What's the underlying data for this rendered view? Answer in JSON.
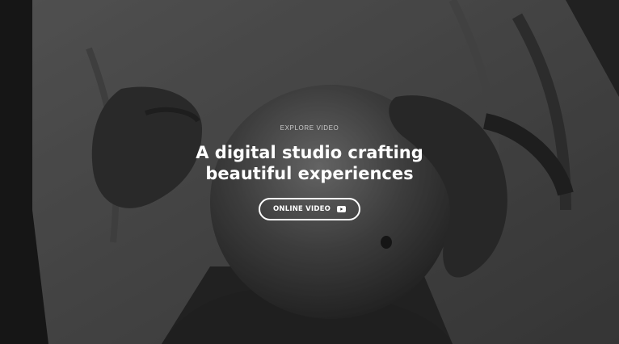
{
  "hero": {
    "eyebrow": "EXPLORE VIDEO",
    "headline_line1": "A digital studio crafting",
    "headline_line2": "beautiful experiences",
    "cta_label": "ONLINE VIDEO",
    "cta_icon": "youtube-play-icon"
  },
  "colors": {
    "text": "#ffffff",
    "eyebrow": "#c9c9c9",
    "overlay": "rgba(0,0,0,0.28)"
  }
}
